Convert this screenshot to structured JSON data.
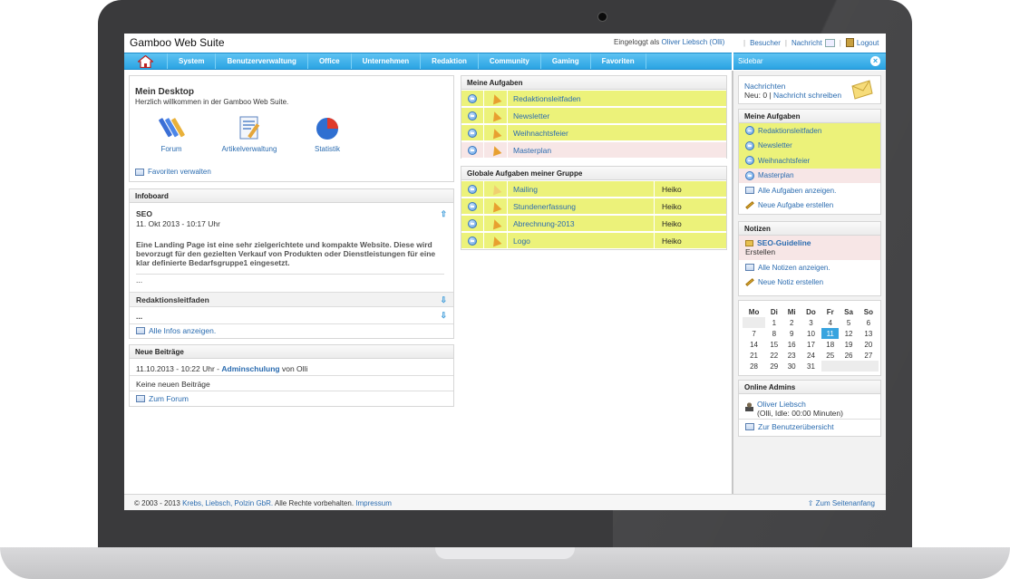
{
  "app": {
    "title": "Gamboo Web Suite"
  },
  "login": {
    "label": "Eingeloggt als",
    "user": "Oliver Liebsch (Olli)"
  },
  "toplinks": {
    "visitors": "Besucher",
    "message": "Nachricht",
    "logout": "Logout"
  },
  "nav": {
    "items": [
      "System",
      "Benutzerverwaltung",
      "Office",
      "Unternehmen",
      "Redaktion",
      "Community",
      "Gaming",
      "Favoriten"
    ]
  },
  "sidebar": {
    "title": "Sidebar"
  },
  "desktop": {
    "title": "Mein Desktop",
    "subtitle": "Herzlich willkommen in der Gamboo Web Suite.",
    "apps": [
      "Forum",
      "Artikelverwaltung",
      "Statistik"
    ],
    "favorites_link": "Favoriten verwalten"
  },
  "infoboard": {
    "title": "Infoboard",
    "post1_title": "SEO",
    "post1_date": "11. Okt 2013 - 10:17 Uhr",
    "post1_body": "Eine Landing Page ist eine sehr zielgerichtete und kompakte Website. Diese wird bevorzugt für den gezielten Verkauf von Produkten oder Dienstleistungen für eine klar definierte Bedarfsgruppe1 eingesetzt.",
    "post1_more": "...",
    "post2_title": "Redaktionsleitfaden",
    "post2_body": "...",
    "all_link": "Alle Infos anzeigen."
  },
  "posts": {
    "title": "Neue Beiträge",
    "date": "11.10.2013 - 10:22 Uhr -",
    "topic": "Adminschulung",
    "by": "von Olli",
    "none": "Keine neuen Beiträge",
    "forum_link": "Zum Forum"
  },
  "my_tasks": {
    "title": "Meine Aufgaben",
    "items": [
      "Redaktionsleitfaden",
      "Newsletter",
      "Weihnachtsfeier",
      "Masterplan"
    ]
  },
  "group_tasks": {
    "title": "Globale Aufgaben meiner Gruppe",
    "items": [
      {
        "name": "Mailing",
        "user": "Heiko"
      },
      {
        "name": "Stundenerfassung",
        "user": "Heiko"
      },
      {
        "name": "Abrechnung-2013",
        "user": "Heiko"
      },
      {
        "name": "Logo",
        "user": "Heiko"
      }
    ]
  },
  "sb_messages": {
    "title": "Nachrichten",
    "count": "Neu: 0 |",
    "write": "Nachricht schreiben"
  },
  "sb_tasks": {
    "title": "Meine Aufgaben",
    "items": [
      "Redaktionsleitfaden",
      "Newsletter",
      "Weihnachtsfeier",
      "Masterplan"
    ],
    "show_all": "Alle Aufgaben anzeigen.",
    "create": "Neue Aufgabe erstellen"
  },
  "sb_notes": {
    "title": "Notizen",
    "note_title": "SEO-Guideline",
    "note_sub": "Erstellen",
    "show_all": "Alle Notizen anzeigen.",
    "create": "Neue Notiz erstellen"
  },
  "calendar": {
    "days": [
      "Mo",
      "Di",
      "Mi",
      "Do",
      "Fr",
      "Sa",
      "So"
    ],
    "weeks": [
      [
        "",
        "1",
        "2",
        "3",
        "4",
        "5",
        "6"
      ],
      [
        "7",
        "8",
        "9",
        "10",
        "11",
        "12",
        "13"
      ],
      [
        "14",
        "15",
        "16",
        "17",
        "18",
        "19",
        "20"
      ],
      [
        "21",
        "22",
        "23",
        "24",
        "25",
        "26",
        "27"
      ],
      [
        "28",
        "29",
        "30",
        "31",
        "",
        "",
        ""
      ]
    ],
    "today": "11"
  },
  "sb_admins": {
    "title": "Online Admins",
    "name": "Oliver Liebsch",
    "status": "(Olli, Idle: 00:00 Minuten)",
    "overview": "Zur Benutzerübersicht"
  },
  "footer": {
    "prefix": "© 2003 - 2013",
    "authors": "Krebs, Liebsch, Polzin GbR.",
    "rights": "Alle Rechte vorbehalten.",
    "imprint": "Impressum",
    "to_top": "Zum Seitenanfang"
  },
  "colors": {
    "nav": "#2aa3e3",
    "task_highlight": "#ecf27a",
    "link": "#2b6cb0"
  }
}
